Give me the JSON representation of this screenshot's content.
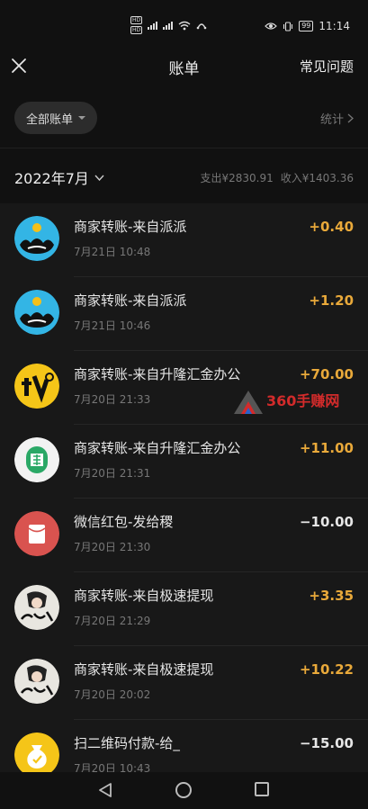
{
  "status_bar": {
    "time": "11:14",
    "battery": "99",
    "hd_top": "HD",
    "hd_bottom": "HD",
    "net_label": "5G"
  },
  "header": {
    "title": "账单",
    "faq_label": "常见问题"
  },
  "filter": {
    "all_bills_label": "全部账单",
    "stats_label": "统计"
  },
  "month": {
    "label": "2022年7月",
    "expense": "支出¥2830.91",
    "income": "收入¥1403.36"
  },
  "transactions": [
    {
      "title": "商家转账-来自派派",
      "time": "7月21日 10:48",
      "amount": "+0.40",
      "direction": "in",
      "icon": "paipai-icon"
    },
    {
      "title": "商家转账-来自派派",
      "time": "7月21日 10:46",
      "amount": "+1.20",
      "direction": "in",
      "icon": "paipai-icon"
    },
    {
      "title": "商家转账-来自升隆汇金办公",
      "time": "7月20日 21:33",
      "amount": "+70.00",
      "direction": "in",
      "icon": "miaodao-icon"
    },
    {
      "title": "商家转账-来自升隆汇金办公",
      "time": "7月20日 21:31",
      "amount": "+11.00",
      "direction": "in",
      "icon": "green-badge-icon"
    },
    {
      "title": "微信红包-发给稷",
      "time": "7月20日 21:30",
      "amount": "−10.00",
      "direction": "out",
      "icon": "red-packet-icon"
    },
    {
      "title": "商家转账-来自极速提现",
      "time": "7月20日 21:29",
      "amount": "+3.35",
      "direction": "in",
      "icon": "xiuxian-icon"
    },
    {
      "title": "商家转账-来自极速提现",
      "time": "7月20日 20:02",
      "amount": "+10.22",
      "direction": "in",
      "icon": "xiuxian-icon"
    },
    {
      "title": "扫二维码付款-给_",
      "time": "7月20日 10:43",
      "amount": "−15.00",
      "direction": "out",
      "icon": "money-bag-icon"
    }
  ],
  "watermark": {
    "text": "360手赚网"
  },
  "colors": {
    "income": "#e9a93a",
    "background": "#111111",
    "list_background": "#181818"
  }
}
